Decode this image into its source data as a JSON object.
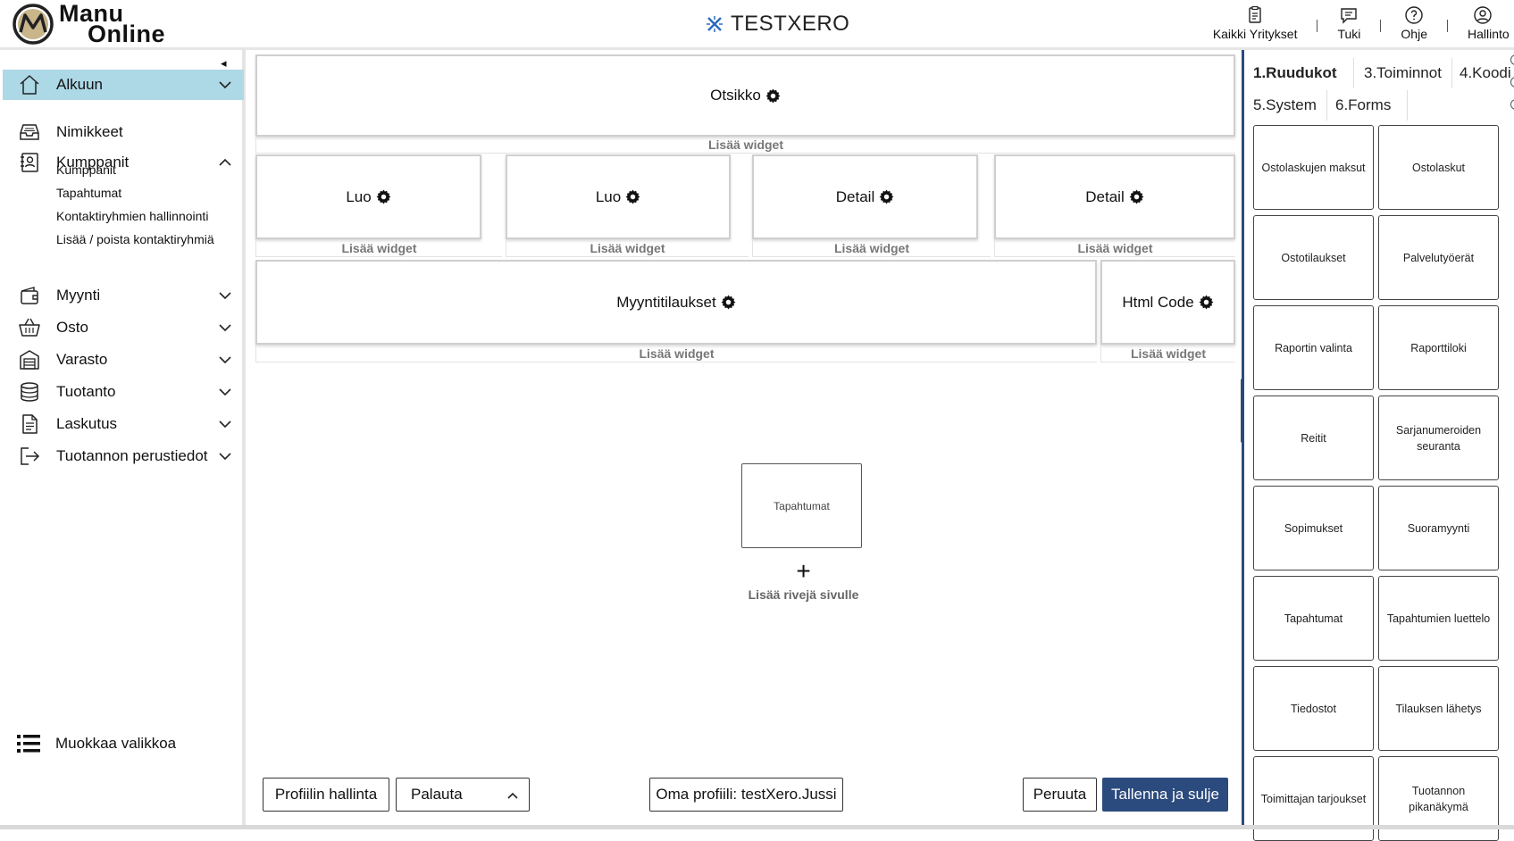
{
  "app": {
    "logo_line1": "Manu",
    "logo_line2": "Online",
    "company": "TESTXERO"
  },
  "topnav": [
    {
      "label": "Kaikki Yritykset",
      "icon": "clipboard-icon"
    },
    {
      "label": "Tuki",
      "icon": "chat-icon"
    },
    {
      "label": "Ohje",
      "icon": "help-circle-icon"
    },
    {
      "label": "Hallinto",
      "icon": "user-circle-icon"
    }
  ],
  "sidebar": {
    "items": [
      {
        "label": "Alkuun",
        "icon": "home-icon",
        "expanded": false,
        "active": true
      },
      {
        "label": "Nimikkeet",
        "icon": "inbox-icon"
      },
      {
        "label": "Kumppanit",
        "icon": "contact-icon",
        "expanded": true
      },
      {
        "label": "Myynti",
        "icon": "wallet-icon",
        "expanded": false
      },
      {
        "label": "Osto",
        "icon": "basket-icon",
        "expanded": false
      },
      {
        "label": "Varasto",
        "icon": "warehouse-icon",
        "expanded": false
      },
      {
        "label": "Tuotanto",
        "icon": "database-icon",
        "expanded": false
      },
      {
        "label": "Laskutus",
        "icon": "document-icon",
        "expanded": false
      },
      {
        "label": "Tuotannon perustiedot",
        "icon": "sign-in-icon",
        "expanded": false
      }
    ],
    "subitems": [
      "Kumppanit",
      "Tapahtumat",
      "Kontaktiryhmien hallinnointi",
      "Lisää / poista kontaktiryhmiä"
    ],
    "edit_menu": "Muokkaa valikkoa"
  },
  "canvas": {
    "rows": [
      {
        "widgets": [
          "Otsikko"
        ],
        "add_label": "Lisää widget"
      },
      {
        "widgets": [
          "Luo",
          "Luo",
          "Detail",
          "Detail"
        ],
        "add_label": "Lisää widget"
      },
      {
        "widgets": [
          "Myyntitilaukset",
          "Html Code"
        ],
        "add_label": "Lisää widget"
      }
    ],
    "drag_card": "Tapahtumat",
    "add_rows_plus": "+",
    "add_rows": "Lisää rivejä sivulle"
  },
  "footer": {
    "profile_mgmt": "Profiilin hallinta",
    "restore": "Palauta",
    "own_profile": "Oma profiili: testXero.Jussi",
    "cancel": "Peruuta",
    "save_close": "Tallenna ja sulje"
  },
  "panel": {
    "tabs": [
      "1.Ruudukot",
      "3.Toiminnot",
      "4.Koodi",
      "5.System",
      "6.Forms"
    ],
    "active_tab": "1.Ruudukot",
    "tiles": [
      "Ostolaskujen maksut",
      "Ostolaskut",
      "Ostotilaukset",
      "Palvelutyöerät",
      "Raportin valinta",
      "Raporttiloki",
      "Reitit",
      "Sarjanumeroiden seuranta",
      "Sopimukset",
      "Suoramyynti",
      "Tapahtumat",
      "Tapahtumien luettelo",
      "Tiedostot",
      "Tilauksen lähetys",
      "Toimittajan tarjoukset",
      "Tuotannon pikanäkymä"
    ]
  },
  "colors": {
    "accent": "#2b4a7d",
    "active_nav": "#add8e6",
    "logo_gold": "#b8a070"
  }
}
